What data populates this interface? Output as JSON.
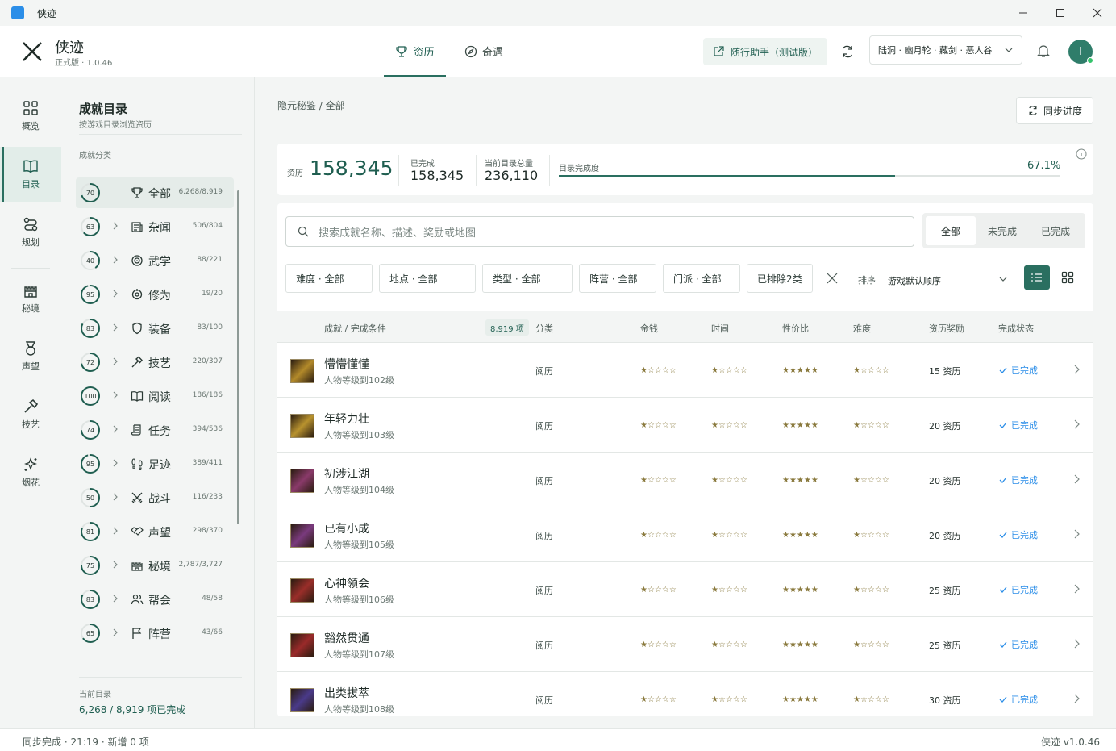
{
  "window": {
    "title": "侠迹"
  },
  "header": {
    "app_name": "侠迹",
    "version": "正式版 · 1.0.46",
    "tabs": [
      {
        "label": "资历",
        "icon": "trophy-icon"
      },
      {
        "label": "奇遇",
        "icon": "compass-icon"
      }
    ],
    "assistant_label": "随行助手（测试版）",
    "server_select": "陆洞 · 幽月轮 · 藏剑 · 恶人谷",
    "avatar_letter": "I"
  },
  "rail": [
    {
      "label": "概览",
      "icon": "grid-icon"
    },
    {
      "label": "目录",
      "icon": "book-icon",
      "active": true
    },
    {
      "label": "规划",
      "icon": "route-icon"
    },
    {
      "label": "秘境",
      "icon": "castle-icon"
    },
    {
      "label": "声望",
      "icon": "medal-icon"
    },
    {
      "label": "技艺",
      "icon": "hammer-icon"
    },
    {
      "label": "烟花",
      "icon": "sparkle-icon"
    }
  ],
  "catalog": {
    "title": "成就目录",
    "subtitle": "按游戏目录浏览资历",
    "section": "成就分类",
    "items": [
      {
        "pct": 70,
        "name": "全部",
        "count": "6,268/8,919",
        "icon": "trophy-icon"
      },
      {
        "pct": 63,
        "name": "杂闻",
        "count": "506/804",
        "icon": "newspaper-icon"
      },
      {
        "pct": 40,
        "name": "武学",
        "count": "88/221",
        "icon": "target-icon"
      },
      {
        "pct": 95,
        "name": "修为",
        "count": "19/20",
        "icon": "focus-icon"
      },
      {
        "pct": 83,
        "name": "装备",
        "count": "83/100",
        "icon": "shield-icon"
      },
      {
        "pct": 72,
        "name": "技艺",
        "count": "220/307",
        "icon": "hammer-icon"
      },
      {
        "pct": 100,
        "name": "阅读",
        "count": "186/186",
        "icon": "book-icon"
      },
      {
        "pct": 74,
        "name": "任务",
        "count": "394/536",
        "icon": "scroll-icon"
      },
      {
        "pct": 95,
        "name": "足迹",
        "count": "389/411",
        "icon": "footprints-icon"
      },
      {
        "pct": 50,
        "name": "战斗",
        "count": "116/233",
        "icon": "swords-icon"
      },
      {
        "pct": 81,
        "name": "声望",
        "count": "298/370",
        "icon": "handshake-icon"
      },
      {
        "pct": 75,
        "name": "秘境",
        "count": "2,787/3,727",
        "icon": "castle-icon"
      },
      {
        "pct": 83,
        "name": "帮会",
        "count": "48/58",
        "icon": "users-icon"
      },
      {
        "pct": 65,
        "name": "阵营",
        "count": "43/66",
        "icon": "flag-icon"
      }
    ],
    "current_label": "当前目录",
    "current_value": "6,268 / 8,919 项已完成"
  },
  "main": {
    "breadcrumb": "隐元秘鉴 / 全部",
    "sync_button": "同步进度",
    "stats": {
      "points_label": "资历",
      "points": "158,345",
      "done_label": "已完成",
      "done": "158,345",
      "total_label": "当前目录总量",
      "total": "236,110",
      "progress_label": "目录完成度",
      "progress_pct": "67.1%",
      "progress_fraction": 0.671
    },
    "search_placeholder": "搜索成就名称、描述、奖励或地图",
    "segments": [
      "全部",
      "未完成",
      "已完成"
    ],
    "filters": [
      "难度 · 全部",
      "地点 · 全部",
      "类型 · 全部",
      "阵营 · 全部",
      "门派 · 全部",
      "已排除2类"
    ],
    "sort_label": "排序",
    "sort_value": "游戏默认顺序",
    "columns": {
      "name": "成就 / 完成条件",
      "count": "8,919 项",
      "category": "分类",
      "money": "金钱",
      "time": "时间",
      "value": "性价比",
      "difficulty": "难度",
      "reward": "资历奖励",
      "status": "完成状态"
    },
    "rows": [
      {
        "name": "懵懵懂懂",
        "cond": "人物等级到102级",
        "cat": "阅历",
        "money": "★☆☆☆☆",
        "time": "★☆☆☆☆",
        "value": "★★★★★",
        "diff": "★☆☆☆☆",
        "reward": "15 资历",
        "status": "已完成",
        "thumb": "#b38a2a"
      },
      {
        "name": "年轻力壮",
        "cond": "人物等级到103级",
        "cat": "阅历",
        "money": "★☆☆☆☆",
        "time": "★☆☆☆☆",
        "value": "★★★★★",
        "diff": "★☆☆☆☆",
        "reward": "20 资历",
        "status": "已完成",
        "thumb": "#b8922e"
      },
      {
        "name": "初涉江湖",
        "cond": "人物等级到104级",
        "cat": "阅历",
        "money": "★☆☆☆☆",
        "time": "★☆☆☆☆",
        "value": "★★★★★",
        "diff": "★☆☆☆☆",
        "reward": "20 资历",
        "status": "已完成",
        "thumb": "#8a3a6a"
      },
      {
        "name": "已有小成",
        "cond": "人物等级到105级",
        "cat": "阅历",
        "money": "★☆☆☆☆",
        "time": "★☆☆☆☆",
        "value": "★★★★★",
        "diff": "★☆☆☆☆",
        "reward": "20 资历",
        "status": "已完成",
        "thumb": "#7a3a7e"
      },
      {
        "name": "心神领会",
        "cond": "人物等级到106级",
        "cat": "阅历",
        "money": "★☆☆☆☆",
        "time": "★☆☆☆☆",
        "value": "★★★★★",
        "diff": "★☆☆☆☆",
        "reward": "25 资历",
        "status": "已完成",
        "thumb": "#9a2e2a"
      },
      {
        "name": "豁然贯通",
        "cond": "人物等级到107级",
        "cat": "阅历",
        "money": "★☆☆☆☆",
        "time": "★☆☆☆☆",
        "value": "★★★★★",
        "diff": "★☆☆☆☆",
        "reward": "25 资历",
        "status": "已完成",
        "thumb": "#9a2a2a"
      },
      {
        "name": "出类拔萃",
        "cond": "人物等级到108级",
        "cat": "阅历",
        "money": "★☆☆☆☆",
        "time": "★☆☆☆☆",
        "value": "★★★★★",
        "diff": "★☆☆☆☆",
        "reward": "30 资历",
        "status": "已完成",
        "thumb": "#4a3a8a"
      }
    ]
  },
  "statusbar": {
    "left": "同步完成 · 21:19 · 新增 0 项",
    "right": "侠迹 v1.0.46"
  }
}
